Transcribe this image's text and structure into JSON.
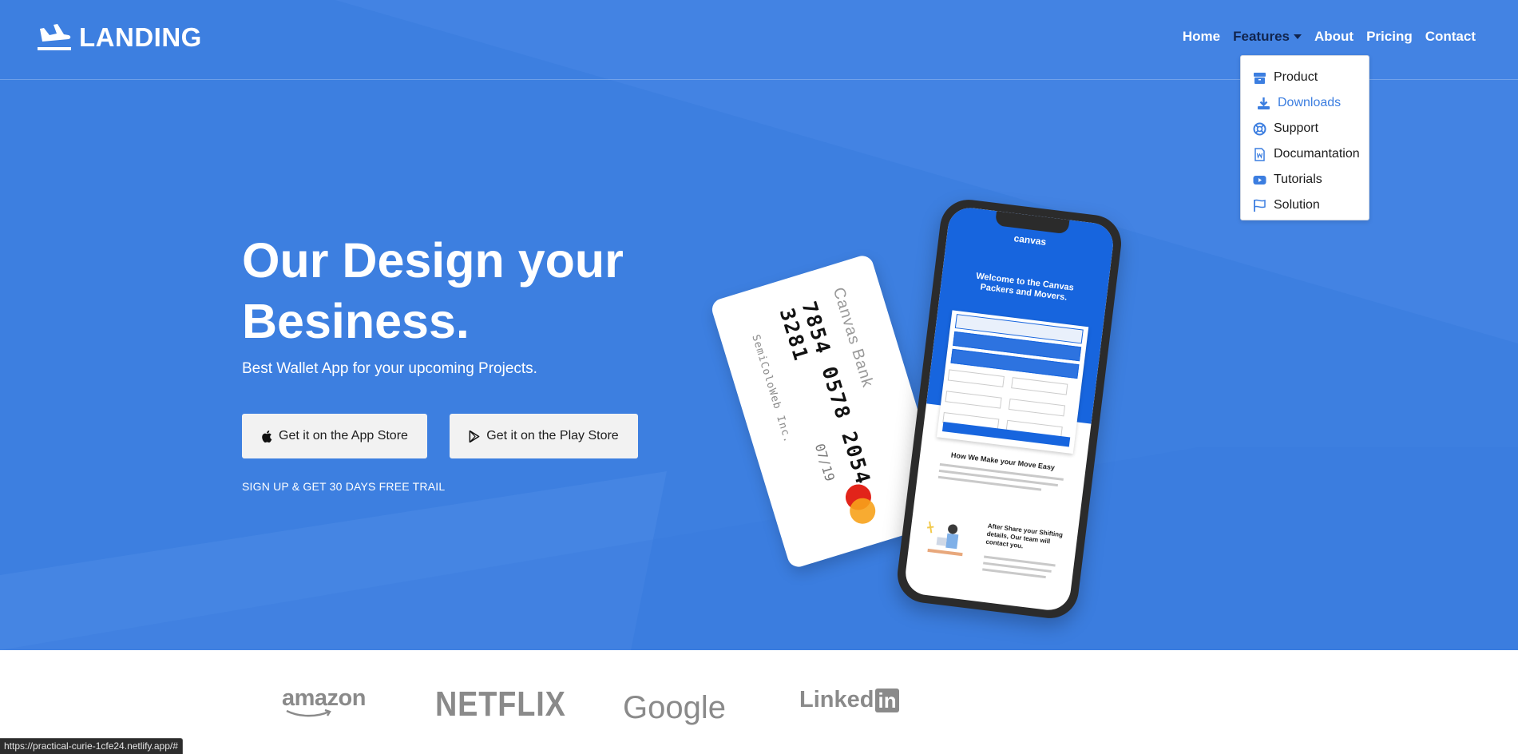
{
  "brand": {
    "name": "LANDING"
  },
  "nav": {
    "items": [
      {
        "label": "Home"
      },
      {
        "label": "Features"
      },
      {
        "label": "About"
      },
      {
        "label": "Pricing"
      },
      {
        "label": "Contact"
      }
    ]
  },
  "features_menu": {
    "items": [
      {
        "label": "Product",
        "icon": "box-icon"
      },
      {
        "label": "Downloads",
        "icon": "download-icon"
      },
      {
        "label": "Support",
        "icon": "lifebuoy-icon"
      },
      {
        "label": "Documantation",
        "icon": "document-icon"
      },
      {
        "label": "Tutorials",
        "icon": "youtube-icon"
      },
      {
        "label": "Solution",
        "icon": "flag-icon"
      }
    ]
  },
  "hero": {
    "title": "Our Design your Besiness.",
    "subtitle": "Best Wallet App for your upcoming Projects.",
    "app_store_label": "Get it on the App Store",
    "play_store_label": "Get it on the Play Store",
    "trial_text": "SIGN UP & GET 30 DAYS FREE TRAIL"
  },
  "card": {
    "bank": "Canvas Bank",
    "number": "7854 0578 2054 3281",
    "holder": "SemiColoWeb Inc.",
    "expiry": "07/19"
  },
  "phone": {
    "logo": "canvas",
    "headline": "Welcome to the Canvas Packers and Movers.",
    "section_title": "How We Make your Move Easy",
    "step_title": "After Share your Shifting details, Our team will contact you."
  },
  "partners": {
    "amazon": "amazon",
    "netflix": "NETFLIX",
    "google": "Google",
    "linkedin_text": "Linked",
    "linkedin_box": "in"
  },
  "status_bar": {
    "url": "https://practical-curie-1cfe24.netlify.app/#"
  },
  "colors": {
    "hero_bg": "#3d7fe0",
    "accent": "#3c7ee0",
    "active_nav": "#11244d"
  }
}
